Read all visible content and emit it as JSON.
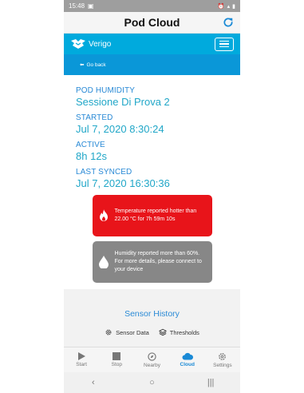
{
  "status_bar": {
    "time": "15:48"
  },
  "header": {
    "title": "Pod Cloud"
  },
  "brand": {
    "name": "Verigo"
  },
  "subnav": {
    "back_label": "Go back"
  },
  "details": [
    {
      "label": "POD HUMIDITY",
      "value": "Sessione Di Prova 2"
    },
    {
      "label": "STARTED",
      "value": "Jul 7, 2020 8:30:24"
    },
    {
      "label": "ACTIVE",
      "value": "8h 12s"
    },
    {
      "label": "LAST SYNCED",
      "value": "Jul 7, 2020 16:30:36"
    }
  ],
  "alerts": [
    {
      "type": "temperature",
      "icon": "flame-icon",
      "color": "#e8141a",
      "text": "Temperature reported hotter than 22.00 °C for 7h 59m 10s"
    },
    {
      "type": "humidity",
      "icon": "droplet-icon",
      "color": "#878787",
      "text": "Humidity reported more than 60%. For more details, please connect to your device"
    }
  ],
  "sensor_history": {
    "title": "Sensor History",
    "links": [
      {
        "label": "Sensor Data",
        "icon": "gear-icon"
      },
      {
        "label": "Thresholds",
        "icon": "layers-icon"
      }
    ]
  },
  "tabs": [
    {
      "label": "Start",
      "icon": "play-icon",
      "active": false
    },
    {
      "label": "Stop",
      "icon": "stop-icon",
      "active": false
    },
    {
      "label": "Nearby",
      "icon": "compass-icon",
      "active": false
    },
    {
      "label": "Cloud",
      "icon": "cloud-icon",
      "active": true
    },
    {
      "label": "Settings",
      "icon": "gear-icon",
      "active": false
    }
  ],
  "colors": {
    "accent": "#00aadd",
    "subnav": "#0a97d8",
    "value_text": "#21a7c8",
    "label_text": "#2a8ad6"
  }
}
